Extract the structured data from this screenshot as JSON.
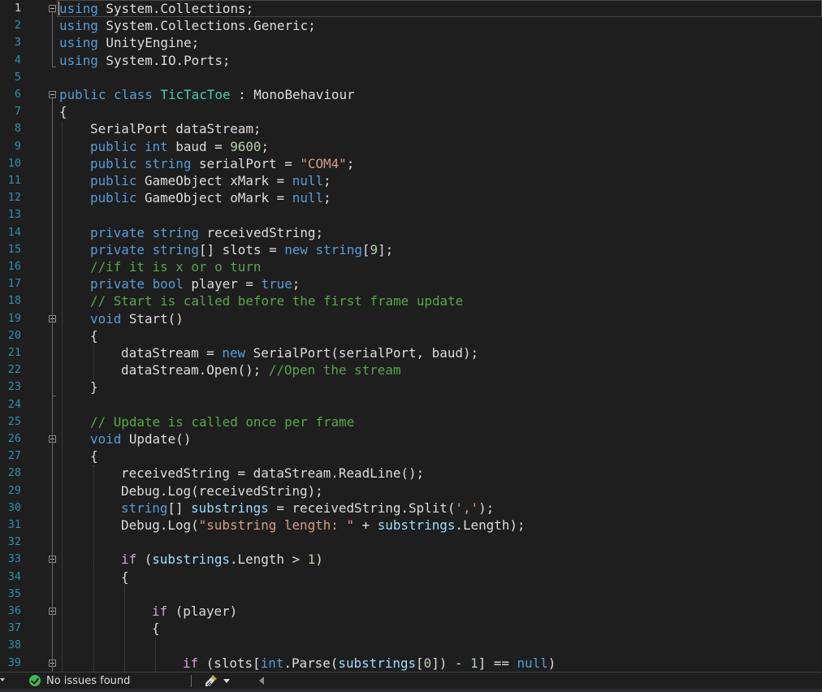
{
  "editor": {
    "line_numbers": [
      "1",
      "2",
      "3",
      "4",
      "5",
      "6",
      "7",
      "8",
      "9",
      "10",
      "11",
      "12",
      "13",
      "14",
      "15",
      "16",
      "17",
      "18",
      "19",
      "20",
      "21",
      "22",
      "23",
      "24",
      "25",
      "26",
      "27",
      "28",
      "29",
      "30",
      "31",
      "32",
      "33",
      "34",
      "35",
      "36",
      "37",
      "38",
      "39"
    ],
    "lines": [
      {
        "indent": 0,
        "tokens": [
          {
            "t": "using",
            "c": "kw"
          },
          {
            "t": " System.Collections;",
            "c": ""
          }
        ]
      },
      {
        "indent": 0,
        "tokens": [
          {
            "t": "using",
            "c": "kw"
          },
          {
            "t": " System.Collections.Generic;",
            "c": ""
          }
        ]
      },
      {
        "indent": 0,
        "tokens": [
          {
            "t": "using",
            "c": "kw"
          },
          {
            "t": " UnityEngine;",
            "c": ""
          }
        ]
      },
      {
        "indent": 0,
        "tokens": [
          {
            "t": "using",
            "c": "kw"
          },
          {
            "t": " System.IO.Ports;",
            "c": ""
          }
        ]
      },
      {
        "indent": 0,
        "tokens": []
      },
      {
        "indent": 0,
        "tokens": [
          {
            "t": "public",
            "c": "kw"
          },
          {
            "t": " ",
            "c": ""
          },
          {
            "t": "class",
            "c": "kw"
          },
          {
            "t": " ",
            "c": ""
          },
          {
            "t": "TicTacToe",
            "c": "typ"
          },
          {
            "t": " : MonoBehaviour",
            "c": ""
          }
        ]
      },
      {
        "indent": 0,
        "tokens": [
          {
            "t": "{",
            "c": ""
          }
        ]
      },
      {
        "indent": 1,
        "tokens": [
          {
            "t": "SerialPort dataStream;",
            "c": ""
          }
        ]
      },
      {
        "indent": 1,
        "tokens": [
          {
            "t": "public",
            "c": "kw"
          },
          {
            "t": " ",
            "c": ""
          },
          {
            "t": "int",
            "c": "kw"
          },
          {
            "t": " baud = ",
            "c": ""
          },
          {
            "t": "9600",
            "c": "num"
          },
          {
            "t": ";",
            "c": ""
          }
        ]
      },
      {
        "indent": 1,
        "tokens": [
          {
            "t": "public",
            "c": "kw"
          },
          {
            "t": " ",
            "c": ""
          },
          {
            "t": "string",
            "c": "kw"
          },
          {
            "t": " serialPort = ",
            "c": ""
          },
          {
            "t": "\"COM4\"",
            "c": "str"
          },
          {
            "t": ";",
            "c": ""
          }
        ]
      },
      {
        "indent": 1,
        "tokens": [
          {
            "t": "public",
            "c": "kw"
          },
          {
            "t": " GameObject xMark = ",
            "c": ""
          },
          {
            "t": "null",
            "c": "kw"
          },
          {
            "t": ";",
            "c": ""
          }
        ]
      },
      {
        "indent": 1,
        "tokens": [
          {
            "t": "public",
            "c": "kw"
          },
          {
            "t": " GameObject oMark = ",
            "c": ""
          },
          {
            "t": "null",
            "c": "kw"
          },
          {
            "t": ";",
            "c": ""
          }
        ]
      },
      {
        "indent": 1,
        "tokens": []
      },
      {
        "indent": 1,
        "tokens": [
          {
            "t": "private",
            "c": "kw"
          },
          {
            "t": " ",
            "c": ""
          },
          {
            "t": "string",
            "c": "kw"
          },
          {
            "t": " receivedString;",
            "c": ""
          }
        ]
      },
      {
        "indent": 1,
        "tokens": [
          {
            "t": "private",
            "c": "kw"
          },
          {
            "t": " ",
            "c": ""
          },
          {
            "t": "string",
            "c": "kw"
          },
          {
            "t": "[] slots = ",
            "c": ""
          },
          {
            "t": "new",
            "c": "kw"
          },
          {
            "t": " ",
            "c": ""
          },
          {
            "t": "string",
            "c": "kw"
          },
          {
            "t": "[",
            "c": ""
          },
          {
            "t": "9",
            "c": "num"
          },
          {
            "t": "];",
            "c": ""
          }
        ]
      },
      {
        "indent": 1,
        "tokens": [
          {
            "t": "//if it is x or o turn",
            "c": "cmt"
          }
        ]
      },
      {
        "indent": 1,
        "tokens": [
          {
            "t": "private",
            "c": "kw"
          },
          {
            "t": " ",
            "c": ""
          },
          {
            "t": "bool",
            "c": "kw"
          },
          {
            "t": " player = ",
            "c": ""
          },
          {
            "t": "true",
            "c": "kw"
          },
          {
            "t": ";",
            "c": ""
          }
        ]
      },
      {
        "indent": 1,
        "tokens": [
          {
            "t": "// Start is called before the first frame update",
            "c": "cmt"
          }
        ]
      },
      {
        "indent": 1,
        "tokens": [
          {
            "t": "void",
            "c": "kw"
          },
          {
            "t": " Start()",
            "c": ""
          }
        ]
      },
      {
        "indent": 1,
        "tokens": [
          {
            "t": "{",
            "c": ""
          }
        ]
      },
      {
        "indent": 2,
        "tokens": [
          {
            "t": "dataStream = ",
            "c": ""
          },
          {
            "t": "new",
            "c": "kw"
          },
          {
            "t": " SerialPort(serialPort, baud);",
            "c": ""
          }
        ]
      },
      {
        "indent": 2,
        "tokens": [
          {
            "t": "dataStream.Open(); ",
            "c": ""
          },
          {
            "t": "//Open the stream",
            "c": "cmt"
          }
        ]
      },
      {
        "indent": 1,
        "tokens": [
          {
            "t": "}",
            "c": ""
          }
        ]
      },
      {
        "indent": 1,
        "tokens": []
      },
      {
        "indent": 1,
        "tokens": [
          {
            "t": "// Update is called once per frame",
            "c": "cmt"
          }
        ]
      },
      {
        "indent": 1,
        "tokens": [
          {
            "t": "void",
            "c": "kw"
          },
          {
            "t": " Update()",
            "c": ""
          }
        ]
      },
      {
        "indent": 1,
        "tokens": [
          {
            "t": "{",
            "c": ""
          }
        ]
      },
      {
        "indent": 2,
        "tokens": [
          {
            "t": "receivedString = dataStream.ReadLine();",
            "c": ""
          }
        ]
      },
      {
        "indent": 2,
        "tokens": [
          {
            "t": "Debug.Log(receivedString);",
            "c": ""
          }
        ]
      },
      {
        "indent": 2,
        "tokens": [
          {
            "t": "string",
            "c": "kw"
          },
          {
            "t": "[] ",
            "c": ""
          },
          {
            "t": "substrings",
            "c": "fld"
          },
          {
            "t": " = receivedString.Split(",
            "c": ""
          },
          {
            "t": "','",
            "c": "str"
          },
          {
            "t": ");",
            "c": ""
          }
        ]
      },
      {
        "indent": 2,
        "tokens": [
          {
            "t": "Debug.Log(",
            "c": ""
          },
          {
            "t": "\"substring length: \"",
            "c": "str"
          },
          {
            "t": " + ",
            "c": ""
          },
          {
            "t": "substrings",
            "c": "fld"
          },
          {
            "t": ".Length);",
            "c": ""
          }
        ]
      },
      {
        "indent": 2,
        "tokens": []
      },
      {
        "indent": 2,
        "tokens": [
          {
            "t": "if",
            "c": "ctl"
          },
          {
            "t": " (",
            "c": ""
          },
          {
            "t": "substrings",
            "c": "fld"
          },
          {
            "t": ".Length > ",
            "c": ""
          },
          {
            "t": "1",
            "c": "num"
          },
          {
            "t": ")",
            "c": ""
          }
        ]
      },
      {
        "indent": 2,
        "tokens": [
          {
            "t": "{",
            "c": ""
          }
        ]
      },
      {
        "indent": 3,
        "tokens": []
      },
      {
        "indent": 3,
        "tokens": [
          {
            "t": "if",
            "c": "ctl"
          },
          {
            "t": " (player)",
            "c": ""
          }
        ]
      },
      {
        "indent": 3,
        "tokens": [
          {
            "t": "{",
            "c": ""
          }
        ]
      },
      {
        "indent": 4,
        "tokens": []
      },
      {
        "indent": 4,
        "tokens": [
          {
            "t": "if",
            "c": "ctl"
          },
          {
            "t": " (slots[",
            "c": ""
          },
          {
            "t": "int",
            "c": "kw"
          },
          {
            "t": ".Parse(",
            "c": ""
          },
          {
            "t": "substrings",
            "c": "fld"
          },
          {
            "t": "[",
            "c": ""
          },
          {
            "t": "0",
            "c": "num"
          },
          {
            "t": "]) - ",
            "c": ""
          },
          {
            "t": "1",
            "c": "num"
          },
          {
            "t": "] == ",
            "c": ""
          },
          {
            "t": "null",
            "c": "kw"
          },
          {
            "t": ")",
            "c": ""
          }
        ]
      }
    ]
  },
  "statusbar": {
    "issues": "No issues found"
  },
  "colors": {
    "keyword": "#569cd6",
    "control": "#d8a0df",
    "type": "#4ec9b0",
    "string": "#d69d85",
    "number": "#b5cea8",
    "comment": "#57a64a",
    "field": "#9cdcfe",
    "ok": "#3fb950"
  },
  "icons": [
    "collapse-icon",
    "check-circle-icon",
    "broom-icon",
    "chevron-down-icon",
    "scroll-left-icon"
  ]
}
